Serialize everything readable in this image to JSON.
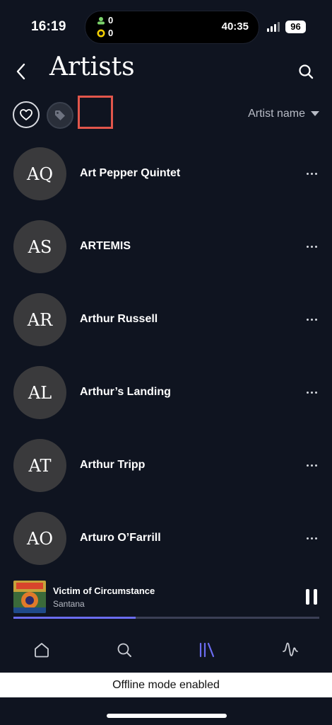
{
  "status_bar": {
    "time": "16:19",
    "island_count_a": "0",
    "island_count_b": "0",
    "island_timer": "40:35",
    "battery": "96"
  },
  "header": {
    "title": "Artists",
    "back_icon": "chevron-left-icon",
    "search_icon": "search-icon"
  },
  "filters": {
    "favorite_icon": "heart-icon",
    "tag_icon": "tag-icon",
    "sort_label": "Artist name"
  },
  "artists": [
    {
      "initials": "AQ",
      "name": "Art Pepper Quintet"
    },
    {
      "initials": "AS",
      "name": "ARTEMIS"
    },
    {
      "initials": "AR",
      "name": "Arthur Russell"
    },
    {
      "initials": "AL",
      "name": "Arthur’s Landing"
    },
    {
      "initials": "AT",
      "name": "Arthur Tripp"
    },
    {
      "initials": "AO",
      "name": "Arturo O’Farrill"
    }
  ],
  "player": {
    "title": "Victim of Circumstance",
    "artist": "Santana",
    "progress": 0.4
  },
  "tabs": [
    {
      "icon": "home-icon",
      "active": false
    },
    {
      "icon": "search-icon",
      "active": false
    },
    {
      "icon": "library-icon",
      "active": true
    },
    {
      "icon": "waveform-icon",
      "active": false
    }
  ],
  "banner": {
    "text": "Offline mode enabled"
  },
  "colors": {
    "background": "#0f1420",
    "accent": "#6b6cf0",
    "highlight": "#e2564b"
  }
}
